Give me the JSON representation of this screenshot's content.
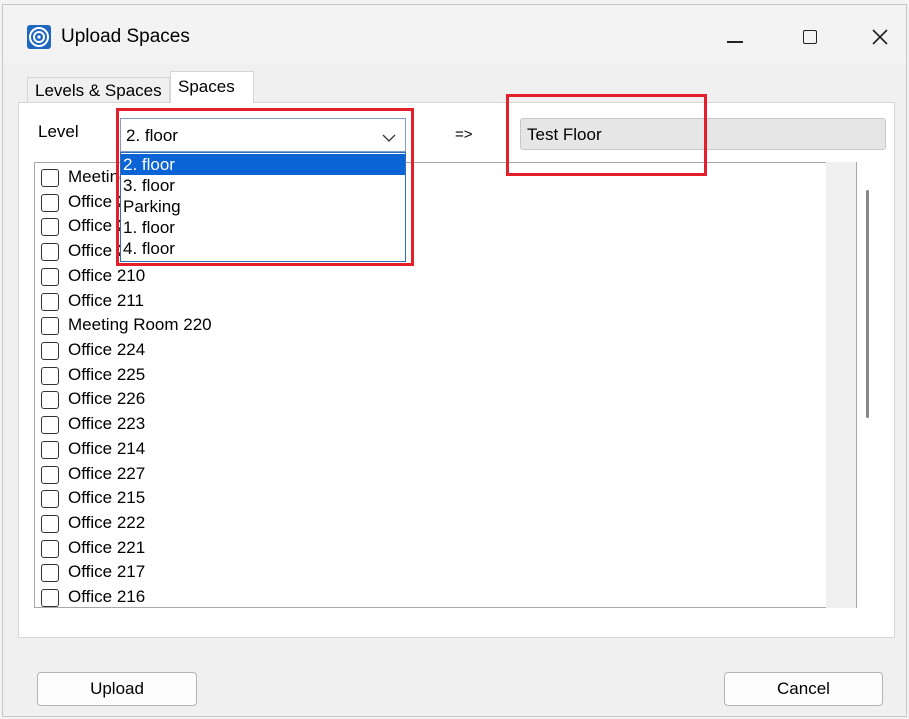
{
  "window": {
    "title": "Upload Spaces"
  },
  "tabs": [
    "Levels & Spaces",
    "Spaces"
  ],
  "level": {
    "label": "Level",
    "selected": "2. floor",
    "options": [
      "2. floor",
      "3. floor",
      "Parking",
      "1. floor",
      "4. floor"
    ]
  },
  "arrow": "=>",
  "target_level": "Test Floor",
  "spaces": [
    "Meeting Room 201",
    "Office 202",
    "Office 203",
    "Office 204",
    "Office 210",
    "Office 211",
    "Meeting Room 220",
    "Office 224",
    "Office 225",
    "Office 226",
    "Office 223",
    "Office 214",
    "Office 227",
    "Office 215",
    "Office 222",
    "Office 221",
    "Office 217",
    "Office 216"
  ],
  "buttons": {
    "upload": "Upload",
    "cancel": "Cancel"
  },
  "icons": {
    "app": "target-logo-icon",
    "minimize": "minimize-icon",
    "maximize": "maximize-icon",
    "close": "close-icon",
    "dropdown": "chevron-down-icon"
  },
  "colors": {
    "selection": "#0a64d6",
    "highlight": "#e21f2b"
  }
}
